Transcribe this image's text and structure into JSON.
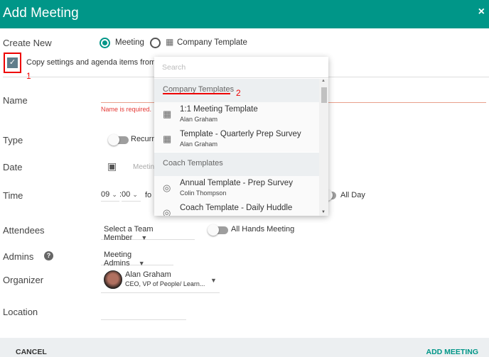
{
  "header": {
    "title": "Add Meeting",
    "close": "×"
  },
  "create_new": {
    "label": "Create New",
    "options": [
      {
        "label": "Meeting",
        "selected": true
      },
      {
        "label": "Company Template",
        "selected": false
      }
    ]
  },
  "copy": {
    "label": "Copy settings and agenda items from",
    "checked": true
  },
  "annotations": {
    "one": "1",
    "two": "2"
  },
  "name": {
    "label": "Name",
    "error": "Name is required."
  },
  "type": {
    "label": "Type",
    "toggle_label": "Recurri"
  },
  "date": {
    "label": "Date",
    "placeholder": "Meetin"
  },
  "time": {
    "label": "Time",
    "hour": "09",
    "minute": "00",
    "sep": ":",
    "for": "fo",
    "all_day": "All Day"
  },
  "attendees": {
    "label": "Attendees",
    "select": "Select a Team Member",
    "all_hands": "All Hands Meeting"
  },
  "admins": {
    "label": "Admins",
    "help": "?",
    "select": "Meeting Admins"
  },
  "organizer": {
    "label": "Organizer",
    "name": "Alan Graham",
    "title": "CEO, VP of People/ Learn..."
  },
  "location": {
    "label": "Location"
  },
  "dropdown": {
    "search_placeholder": "Search",
    "groups": [
      {
        "label": "Company Templates",
        "icon": "building-icon",
        "items": [
          {
            "title": "1:1 Meeting Template",
            "owner": "Alan Graham"
          },
          {
            "title": "Template - Quarterly Prep Survey",
            "owner": "Alan Graham"
          }
        ]
      },
      {
        "label": "Coach Templates",
        "icon": "user-circle-icon",
        "items": [
          {
            "title": "Annual Template - Prep Survey",
            "owner": "Colin Thompson"
          },
          {
            "title": "Coach Template - Daily Huddle",
            "owner": ""
          }
        ]
      }
    ]
  },
  "footer": {
    "cancel": "CANCEL",
    "add": "ADD MEETING"
  },
  "colors": {
    "accent": "#009688",
    "error": "#e53935"
  }
}
